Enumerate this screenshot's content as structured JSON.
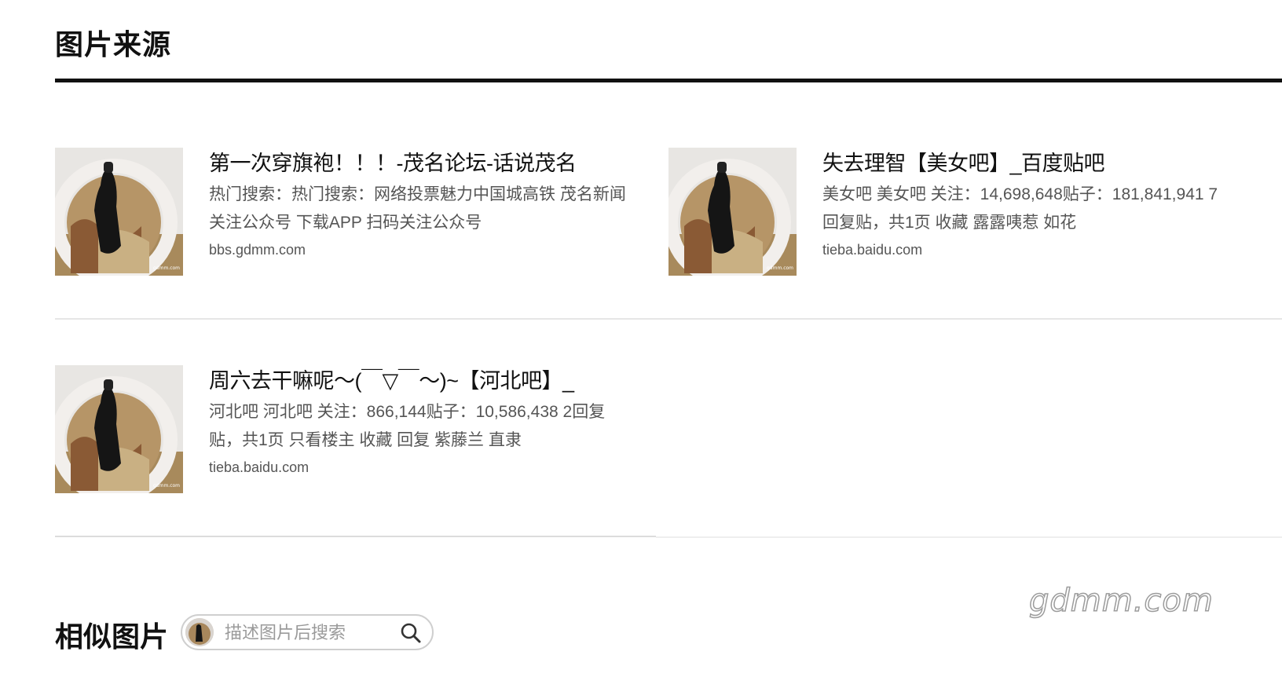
{
  "header": {
    "title": "图片来源"
  },
  "results": [
    {
      "title": "第一次穿旗袍！！！-茂名论坛-话说茂名",
      "description": "热门搜索：热门搜索：网络投票魅力中国城高铁 茂名新闻 关注公众号 下载APP 扫码关注公众号",
      "site": "bbs.gdmm.com"
    },
    {
      "title": "失去理智【美女吧】_百度贴吧",
      "description": "美女吧 美女吧 关注：14,698,648贴子：181,841,941 7回复贴，共1页 收藏 露露咦惹 如花",
      "site": "tieba.baidu.com"
    },
    {
      "title": "周六去干嘛呢～(￣▽￣～)~【河北吧】_",
      "description": "河北吧 河北吧 关注：866,144贴子：10,586,438 2回复贴，共1页 只看楼主 收藏 回复 紫藤兰 直隶",
      "site": "tieba.baidu.com"
    }
  ],
  "similar": {
    "title": "相似图片",
    "search_placeholder": "描述图片后搜索",
    "search_icon": "search-icon"
  },
  "watermark": "gdmm.com"
}
